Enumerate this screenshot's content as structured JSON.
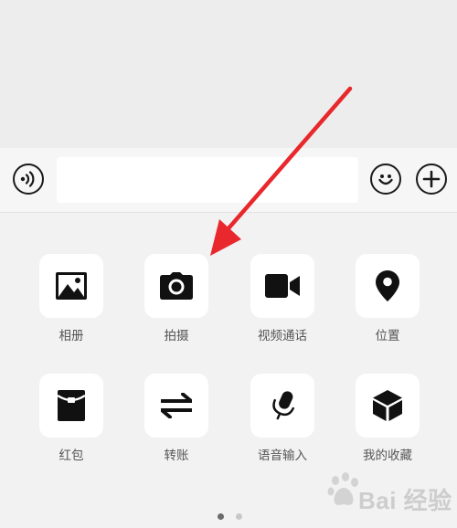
{
  "input_bar": {
    "voice_icon": "voice-waves-icon",
    "emoji_icon": "smiley-face-icon",
    "plus_icon": "plus-icon",
    "message_value": "",
    "message_placeholder": ""
  },
  "panel": {
    "items": [
      {
        "label": "相册",
        "icon": "photo-album-icon"
      },
      {
        "label": "拍摄",
        "icon": "camera-icon"
      },
      {
        "label": "视频通话",
        "icon": "video-camera-icon"
      },
      {
        "label": "位置",
        "icon": "location-pin-icon"
      },
      {
        "label": "红包",
        "icon": "red-envelope-icon"
      },
      {
        "label": "转账",
        "icon": "transfer-arrows-icon"
      },
      {
        "label": "语音输入",
        "icon": "microphone-icon"
      },
      {
        "label": "我的收藏",
        "icon": "favorites-cube-icon"
      }
    ],
    "pages": {
      "current": 1,
      "total": 2
    }
  },
  "annotation": {
    "color": "#e8282d"
  },
  "watermark": {
    "brand": "Bai 经验"
  },
  "colors": {
    "icon": "#111111",
    "dot_active": "#6a6a6a",
    "dot_inactive": "#c8c8c8"
  }
}
